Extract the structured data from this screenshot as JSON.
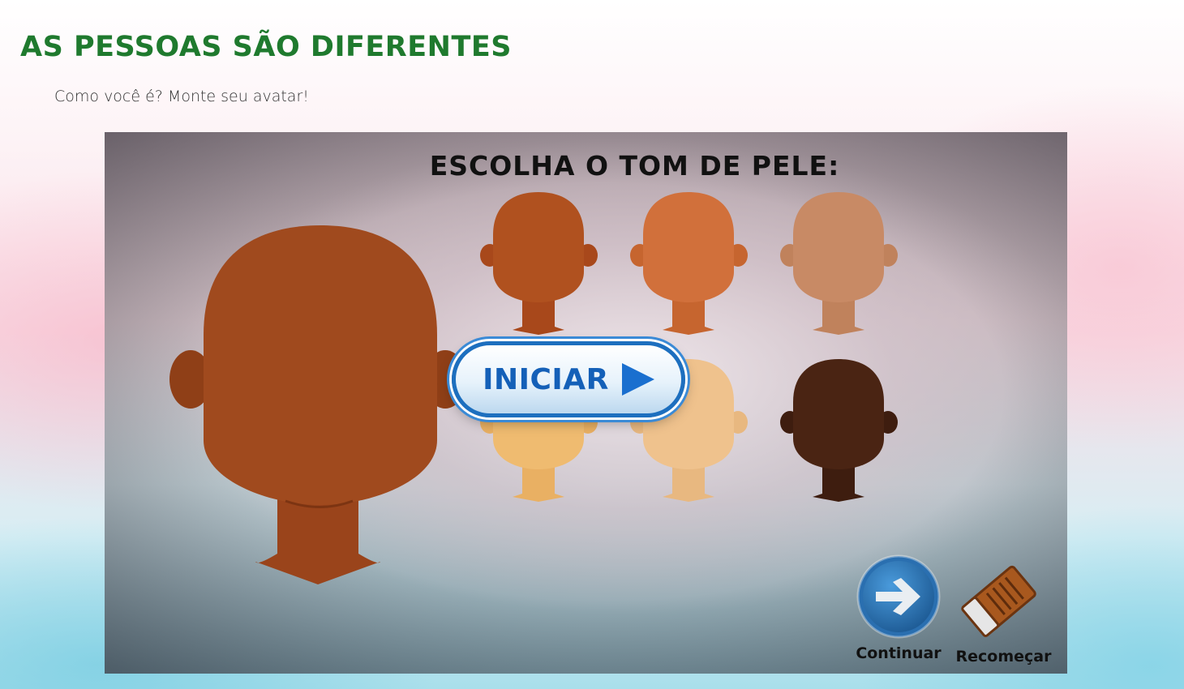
{
  "page": {
    "title": "AS PESSOAS SÃO DIFERENTES",
    "subtitle": "Como você é? Monte seu avatar!"
  },
  "game": {
    "heading": "ESCOLHA O TOM DE PELE:",
    "start_label": "INICIAR",
    "continue_label": "Continuar",
    "restart_label": "Recomeçar",
    "selected_skin_tone": "#a04a1e",
    "skin_tones": [
      {
        "name": "skin-tone-1",
        "color": "#b0511f"
      },
      {
        "name": "skin-tone-2",
        "color": "#d1703b"
      },
      {
        "name": "skin-tone-3",
        "color": "#c88a65"
      },
      {
        "name": "skin-tone-4",
        "color": "#efbb70"
      },
      {
        "name": "skin-tone-5",
        "color": "#efc28d"
      },
      {
        "name": "skin-tone-6",
        "color": "#4a2413"
      }
    ],
    "icons": {
      "start": "play-icon",
      "continue": "arrow-right-icon",
      "restart": "eraser-icon"
    }
  },
  "colors": {
    "title_green": "#1f7a2e",
    "button_blue": "#1d6fbf"
  }
}
